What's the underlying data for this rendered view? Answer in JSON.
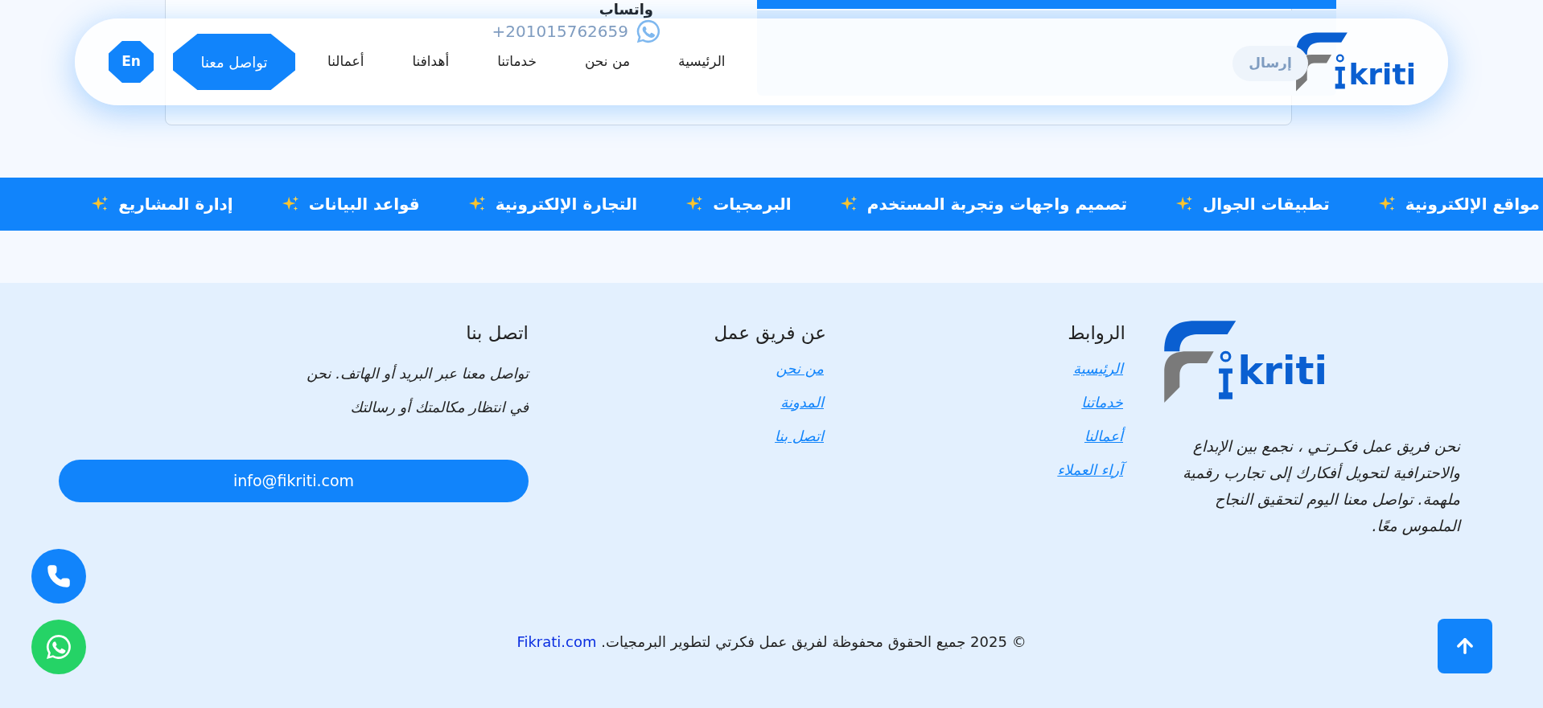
{
  "behind": {
    "whatsapp_label": "واتساب",
    "phone": "+201015762659",
    "send_button": "إرسال"
  },
  "header": {
    "logo_text": "kriti",
    "nav": [
      {
        "label": "الرئيسية"
      },
      {
        "label": "من نحن"
      },
      {
        "label": "خدماتنا"
      },
      {
        "label": "أهدافنا"
      },
      {
        "label": "أعمالنا"
      }
    ],
    "contact_button": "تواصل معنا",
    "language_button": "En"
  },
  "ticker": [
    "مواقع الإلكترونية",
    "تطبيقات الجوال",
    "تصميم واجهات وتجربة المستخدم",
    "البرمجيات",
    "التجارة الإلكترونية",
    "قواعد البيانات",
    "إدارة المشاريع"
  ],
  "footer": {
    "logo_text": "kriti",
    "about": "نحن فريق عمل فكـرتـي ، نجمع بين الإبداع والاحترافية لتحويل أفكارك إلى تجارب رقمية ملهمة. تواصل معنا اليوم لتحقيق النجاح الملموس معًا.",
    "columns": [
      {
        "title": "الروابط",
        "links": [
          "الرئيسية",
          "خدماتنا",
          "أعمالنا",
          "آراء العملاء"
        ]
      },
      {
        "title": "عن فريق عمل",
        "links": [
          "من نحن",
          "المدونة",
          "اتصل بنا"
        ]
      }
    ],
    "contact": {
      "title": "اتصل بنا",
      "lines": [
        "تواصل معنا عبر البريد أو الهاتف. نحن",
        "في انتظار مكالمتك أو رسالتك"
      ],
      "email": "info@fikriti.com"
    },
    "copyright": "© 2025 جميع الحقوق محفوظة لفريق عمل فكرتي لتطوير البرمجيات.",
    "copyright_link": "Fikrati.com"
  }
}
